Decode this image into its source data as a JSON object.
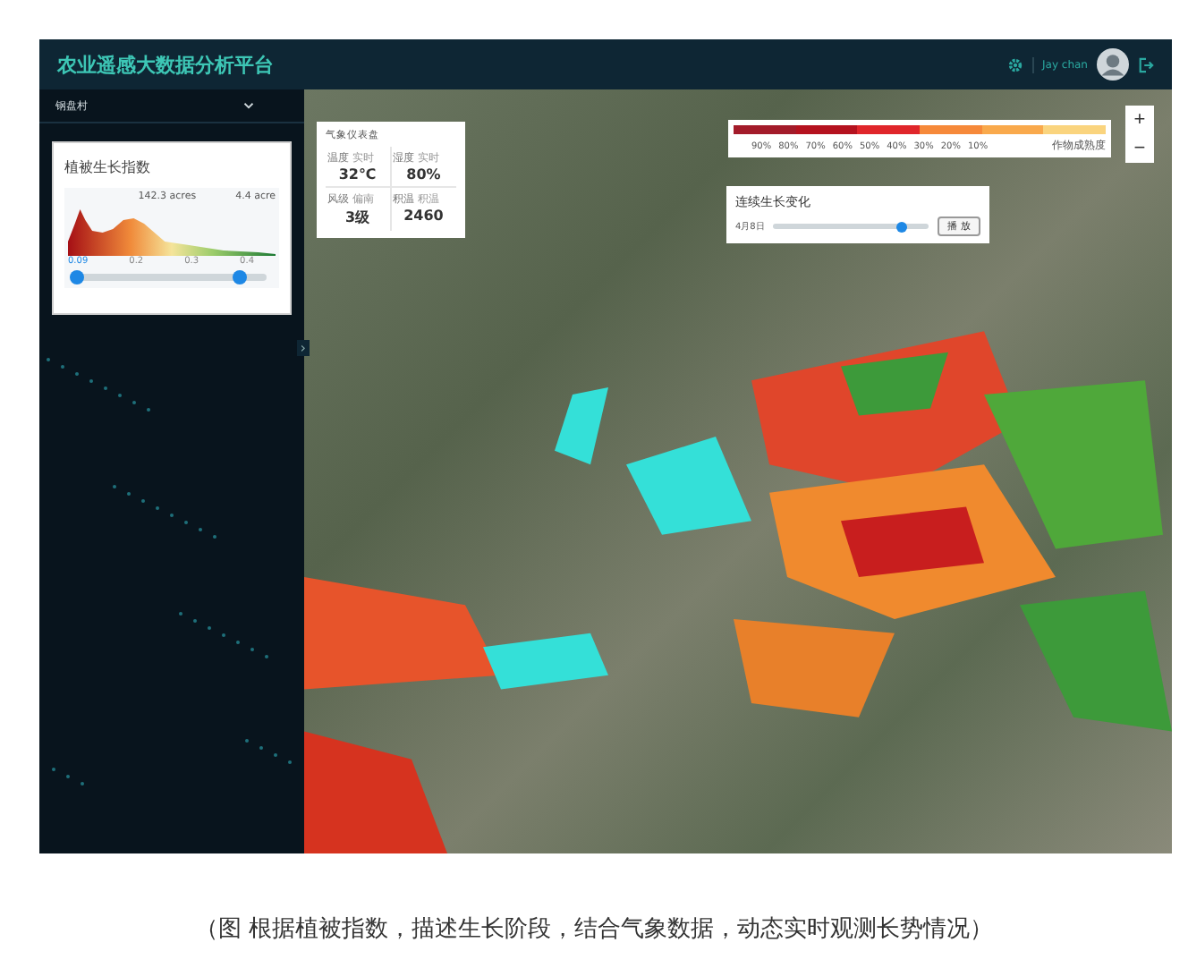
{
  "header": {
    "title": "农业遥感大数据分析平台",
    "user_name": "Jay chan"
  },
  "sidebar": {
    "village_select": {
      "value": "钢盘村"
    },
    "vegetation_card": {
      "title": "植被生长指数",
      "area_labels": [
        "142.3 acres",
        "4.4 acre"
      ],
      "ticks": [
        "0.09",
        "0.2",
        "0.3",
        "0.4"
      ],
      "range_handles": [
        {
          "level": 0
        },
        {
          "level": 0.86
        }
      ]
    },
    "collapse_handle": "›"
  },
  "weather_panel": {
    "title": "气象仪表盘",
    "cells": [
      {
        "label": "温度",
        "note": "实时",
        "value": "32℃"
      },
      {
        "label": "湿度",
        "note": "实时",
        "value": "80%"
      },
      {
        "label": "风级",
        "note": "偏南",
        "value": "3级"
      },
      {
        "label": "积温",
        "note": "积温",
        "value": "2460"
      }
    ]
  },
  "legend": {
    "segments": [
      {
        "color": "#a31b2a"
      },
      {
        "color": "#b5121f"
      },
      {
        "color": "#e0262b"
      },
      {
        "color": "#f6893a"
      },
      {
        "color": "#f9a94c"
      },
      {
        "color": "#fad47e"
      }
    ],
    "labels": [
      "90%",
      "80%",
      "70%",
      "60%",
      "50%",
      "40%",
      "30%",
      "20%",
      "10%"
    ],
    "caption": "作物成熟度"
  },
  "growth_panel": {
    "title": "连续生长变化",
    "date": "4月8日",
    "level": 0.82,
    "play_button": "播 放"
  },
  "zoom": {
    "in": "+",
    "out": "−"
  },
  "caption": "（图  根据植被指数，描述生长阶段，结合气象数据，动态实时观测长势情况）"
}
